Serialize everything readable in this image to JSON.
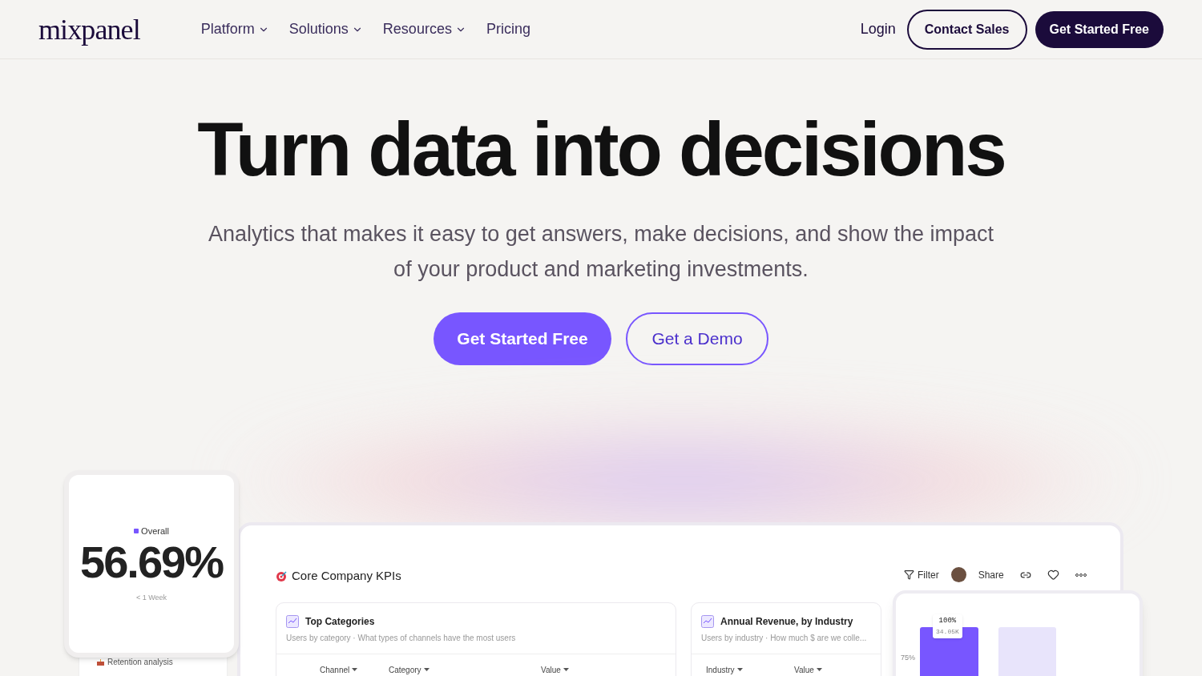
{
  "nav": {
    "logo": "mixpanel",
    "links": [
      {
        "label": "Platform",
        "dropdown": true
      },
      {
        "label": "Solutions",
        "dropdown": true
      },
      {
        "label": "Resources",
        "dropdown": true
      },
      {
        "label": "Pricing",
        "dropdown": false
      }
    ],
    "login": "Login",
    "contact": "Contact Sales",
    "cta": "Get Started Free"
  },
  "hero": {
    "title": "Turn data into decisions",
    "subtitle": "Analytics that makes it easy to get answers, make decisions, and show the impact of your product and marketing investments.",
    "primary": "Get Started Free",
    "secondary": "Get a Demo"
  },
  "kpi_card": {
    "legend": "Overall",
    "color": "#7856ff",
    "value": "56.69%",
    "caption": "< 1 Week"
  },
  "sidebar_item": "Retention analysis",
  "dashboard": {
    "title": "Core Company KPIs",
    "filter": "Filter",
    "share": "Share",
    "cards": [
      {
        "title": "Top Categories",
        "subtitle": "Users by category · What types of channels have the most users",
        "columns": [
          "Channel",
          "Category",
          "Value"
        ]
      },
      {
        "title": "Annual Revenue, by Industry",
        "subtitle": "Users by industry · How much $ are we colle...",
        "columns": [
          "Industry",
          "Value"
        ]
      }
    ]
  },
  "chart_card": {
    "tooltip_value": "100%",
    "tooltip_sub": "34.05K",
    "axis_label": "75%"
  }
}
